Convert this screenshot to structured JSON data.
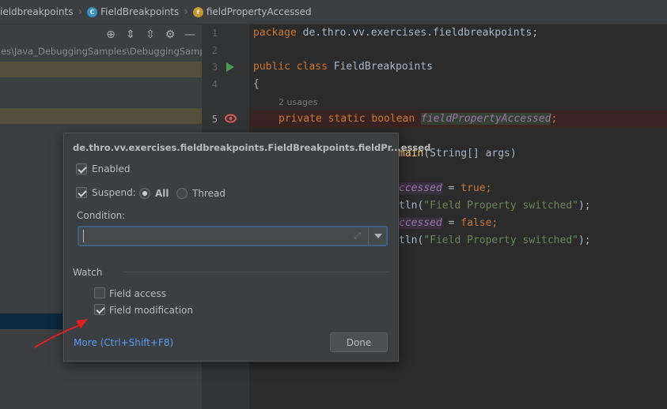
{
  "breadcrumb": {
    "items": [
      "ieldbreakpoints",
      "FieldBreakpoints",
      "fieldPropertyAccessed"
    ]
  },
  "left_panel": {
    "path_text": "es\\Java_DebuggingSamples\\DebuggingSamples"
  },
  "editor": {
    "line_numbers": [
      "1",
      "2",
      "3",
      "4",
      "5"
    ],
    "lines": {
      "l1_kw": "package",
      "l1_rest": " de.thro.vv.exercises.fieldbreakpoints;",
      "l3_kw": "public class",
      "l3_rest": " FieldBreakpoints",
      "l4": "{",
      "usages": "2 usages",
      "l5_kw": "private static boolean",
      "l5_field": "fieldPropertyAccessed",
      "l5_end": ";",
      "l7_fn": "main",
      "l7_rest": "(String[] args)",
      "l9_field": "ccessed",
      "l9_rest": " = ",
      "l9_kw": "true",
      "l9_end": ";",
      "l10_pre": "tln(",
      "l10_str": "\"Field Property switched\"",
      "l10_end": ");",
      "l11_field": "ccessed",
      "l11_rest": " = ",
      "l11_kw": "false",
      "l11_end": ";",
      "l12_pre": "tln(",
      "l12_str": "\"Field Property switched\"",
      "l12_end": ");"
    }
  },
  "popup": {
    "title": "de.thro.vv.exercises.fieldbreakpoints.FieldBreakpoints.fieldPr...essed",
    "enabled_label": "Enabled",
    "enabled_checked": true,
    "suspend_label": "Suspend:",
    "suspend_checked": true,
    "suspend_all_label": "All",
    "suspend_thread_label": "Thread",
    "suspend_selected": "All",
    "condition_label": "Condition:",
    "condition_value": "",
    "watch_label": "Watch",
    "field_access_label": "Field access",
    "field_access_checked": false,
    "field_modification_label": "Field modification",
    "field_modification_checked": true,
    "more_link": "More (Ctrl+Shift+F8)",
    "done_label": "Done"
  },
  "colors": {
    "accent_link": "#589df6",
    "breakpoint_line_bg": "#3a2323",
    "annotation_arrow": "#e02020"
  },
  "icons": [
    "class-icon",
    "field-icon",
    "crosshair-icon",
    "expand-all-icon",
    "collapse-all-icon",
    "gear-icon",
    "minimize-icon",
    "run-gutter-icon",
    "field-breakpoint-icon",
    "expand-editor-icon",
    "dropdown-arrow-icon"
  ]
}
